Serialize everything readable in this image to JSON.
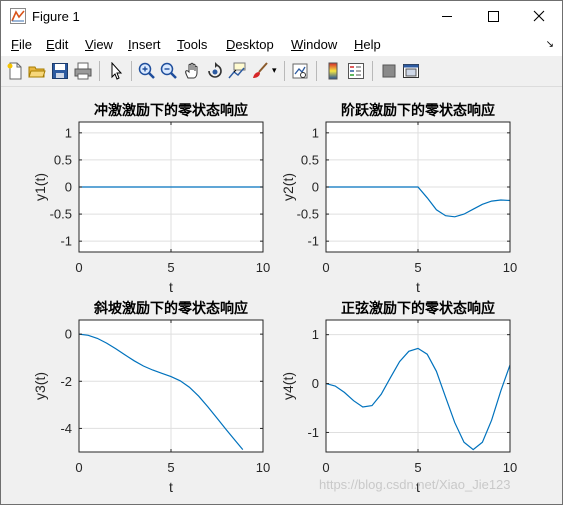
{
  "window": {
    "title": "Figure 1"
  },
  "menu": [
    "File",
    "Edit",
    "View",
    "Insert",
    "Tools",
    "Desktop",
    "Window",
    "Help"
  ],
  "toolbar_icons": [
    "new-figure-icon",
    "open-file-icon",
    "save-icon",
    "print-icon",
    "pointer-icon",
    "zoom-in-icon",
    "zoom-out-icon",
    "pan-icon",
    "rotate-icon",
    "data-cursor-icon",
    "brush-icon",
    "link-icon",
    "colorbar-icon",
    "legend-icon",
    "hide-plot-tools-icon",
    "show-plot-tools-icon"
  ],
  "colors": {
    "line": "#0072bd",
    "axes_bg": "#ffffff",
    "figure_bg": "#f0f0f0",
    "grid": "#dfdfdf"
  },
  "watermark": "https://blog.csdn.net/Xiao_Jie123",
  "chart_data": [
    {
      "type": "line",
      "title": "冲激激励下的零状态响应",
      "xlabel": "t",
      "ylabel": "y1(t)",
      "xlim": [
        0,
        10
      ],
      "ylim": [
        -1.2,
        1.2
      ],
      "xticks": [
        0,
        5,
        10
      ],
      "yticks": [
        -1,
        -0.5,
        0,
        0.5,
        1
      ],
      "xtick_labels": [
        "0",
        "5",
        "10"
      ],
      "ytick_labels": [
        "-1",
        "-0.5",
        "0",
        "0.5",
        "1"
      ],
      "grid": true,
      "x": [
        0,
        2,
        4,
        6,
        8,
        10
      ],
      "y": [
        0,
        0,
        0,
        0,
        0,
        0
      ]
    },
    {
      "type": "line",
      "title": "阶跃激励下的零状态响应",
      "xlabel": "t",
      "ylabel": "y2(t)",
      "xlim": [
        0,
        10
      ],
      "ylim": [
        -1.2,
        1.2
      ],
      "xticks": [
        0,
        5,
        10
      ],
      "yticks": [
        -1,
        -0.5,
        0,
        0.5,
        1
      ],
      "xtick_labels": [
        "0",
        "5",
        "10"
      ],
      "ytick_labels": [
        "-1",
        "-0.5",
        "0",
        "0.5",
        "1"
      ],
      "grid": true,
      "x": [
        0,
        1,
        2,
        3,
        4,
        5,
        5.5,
        6,
        6.5,
        7,
        7.5,
        8,
        8.5,
        9,
        9.5,
        10
      ],
      "y": [
        0,
        0,
        0,
        0,
        0,
        0,
        -0.2,
        -0.42,
        -0.53,
        -0.55,
        -0.5,
        -0.41,
        -0.32,
        -0.26,
        -0.24,
        -0.25
      ]
    },
    {
      "type": "line",
      "title": "斜坡激励下的零状态响应",
      "xlabel": "t",
      "ylabel": "y3(t)",
      "xlim": [
        0,
        10
      ],
      "ylim": [
        -5,
        0.6
      ],
      "xticks": [
        0,
        5,
        10
      ],
      "yticks": [
        -4,
        -2,
        0
      ],
      "xtick_labels": [
        "0",
        "5",
        "10"
      ],
      "ytick_labels": [
        "-4",
        "-2",
        "0"
      ],
      "grid": true,
      "x": [
        0,
        0.5,
        1,
        1.5,
        2,
        2.5,
        3,
        3.5,
        4,
        4.5,
        5,
        5.5,
        6,
        6.5,
        7,
        7.5,
        8,
        8.5,
        8.9
      ],
      "y": [
        0,
        -0.05,
        -0.18,
        -0.38,
        -0.62,
        -0.88,
        -1.13,
        -1.35,
        -1.52,
        -1.66,
        -1.8,
        -1.98,
        -2.25,
        -2.63,
        -3.08,
        -3.56,
        -4.05,
        -4.52,
        -4.9
      ]
    },
    {
      "type": "line",
      "title": "正弦激励下的零状态响应",
      "xlabel": "t",
      "ylabel": "y4(t)",
      "xlim": [
        0,
        10
      ],
      "ylim": [
        -1.4,
        1.3
      ],
      "xticks": [
        0,
        5,
        10
      ],
      "yticks": [
        -1,
        0,
        1
      ],
      "xtick_labels": [
        "0",
        "5",
        "10"
      ],
      "ytick_labels": [
        "-1",
        "0",
        "1"
      ],
      "grid": true,
      "x": [
        0,
        0.5,
        1,
        1.5,
        2,
        2.5,
        3,
        3.5,
        4,
        4.5,
        5,
        5.5,
        6,
        6.5,
        7,
        7.5,
        8,
        8.5,
        9,
        9.5,
        10
      ],
      "y": [
        0,
        -0.05,
        -0.18,
        -0.35,
        -0.48,
        -0.45,
        -0.22,
        0.12,
        0.45,
        0.66,
        0.72,
        0.6,
        0.25,
        -0.28,
        -0.8,
        -1.2,
        -1.35,
        -1.2,
        -0.75,
        -0.15,
        0.38
      ]
    }
  ]
}
